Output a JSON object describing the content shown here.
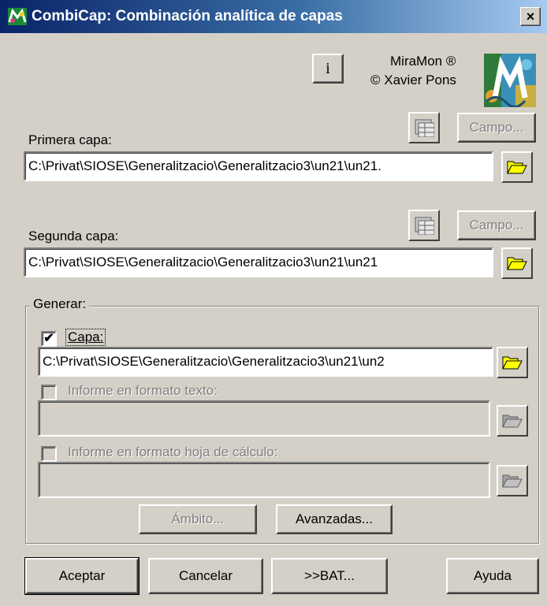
{
  "window": {
    "title": "CombiCap: Combinación analítica de capas",
    "close_label": "×"
  },
  "about": {
    "info_button_label": "i",
    "product": "MiraMon ®",
    "author": "© Xavier Pons"
  },
  "primera": {
    "label": "Primera capa:",
    "value": "C:\\Privat\\SIOSE\\Generalitzacio\\Generalitzacio3\\un21\\un21.",
    "campo_label": "Campo..."
  },
  "segunda": {
    "label": "Segunda capa:",
    "value": "C:\\Privat\\SIOSE\\Generalitzacio\\Generalitzacio3\\un21\\un21",
    "campo_label": "Campo..."
  },
  "generar": {
    "title": "Generar:",
    "capa": {
      "label": "Capa:",
      "checked": true,
      "check_mark": "✔",
      "value": "C:\\Privat\\SIOSE\\Generalitzacio\\Generalitzacio3\\un21\\un2"
    },
    "informe_texto": {
      "label": "Informe en formato texto:",
      "checked": false,
      "value": ""
    },
    "informe_hoja": {
      "label": "Informe en formato hoja de cálculo:",
      "checked": false,
      "value": ""
    },
    "ambito_label": "Ámbito...",
    "avanzadas_label": "Avanzadas..."
  },
  "footer": {
    "aceptar": "Aceptar",
    "cancelar": "Cancelar",
    "bat": ">>BAT...",
    "ayuda": "Ayuda"
  },
  "icons": {
    "open_folder": "folder-open-icon",
    "table_selector": "table-icon",
    "app": "miramon-app-icon",
    "logo": "miramon-logo"
  },
  "colors": {
    "title_bar_start": "#0a246a",
    "title_bar_end": "#a6caf0",
    "folder_yellow": "#ffff00",
    "dialog_bg": "#d4d0c8"
  }
}
